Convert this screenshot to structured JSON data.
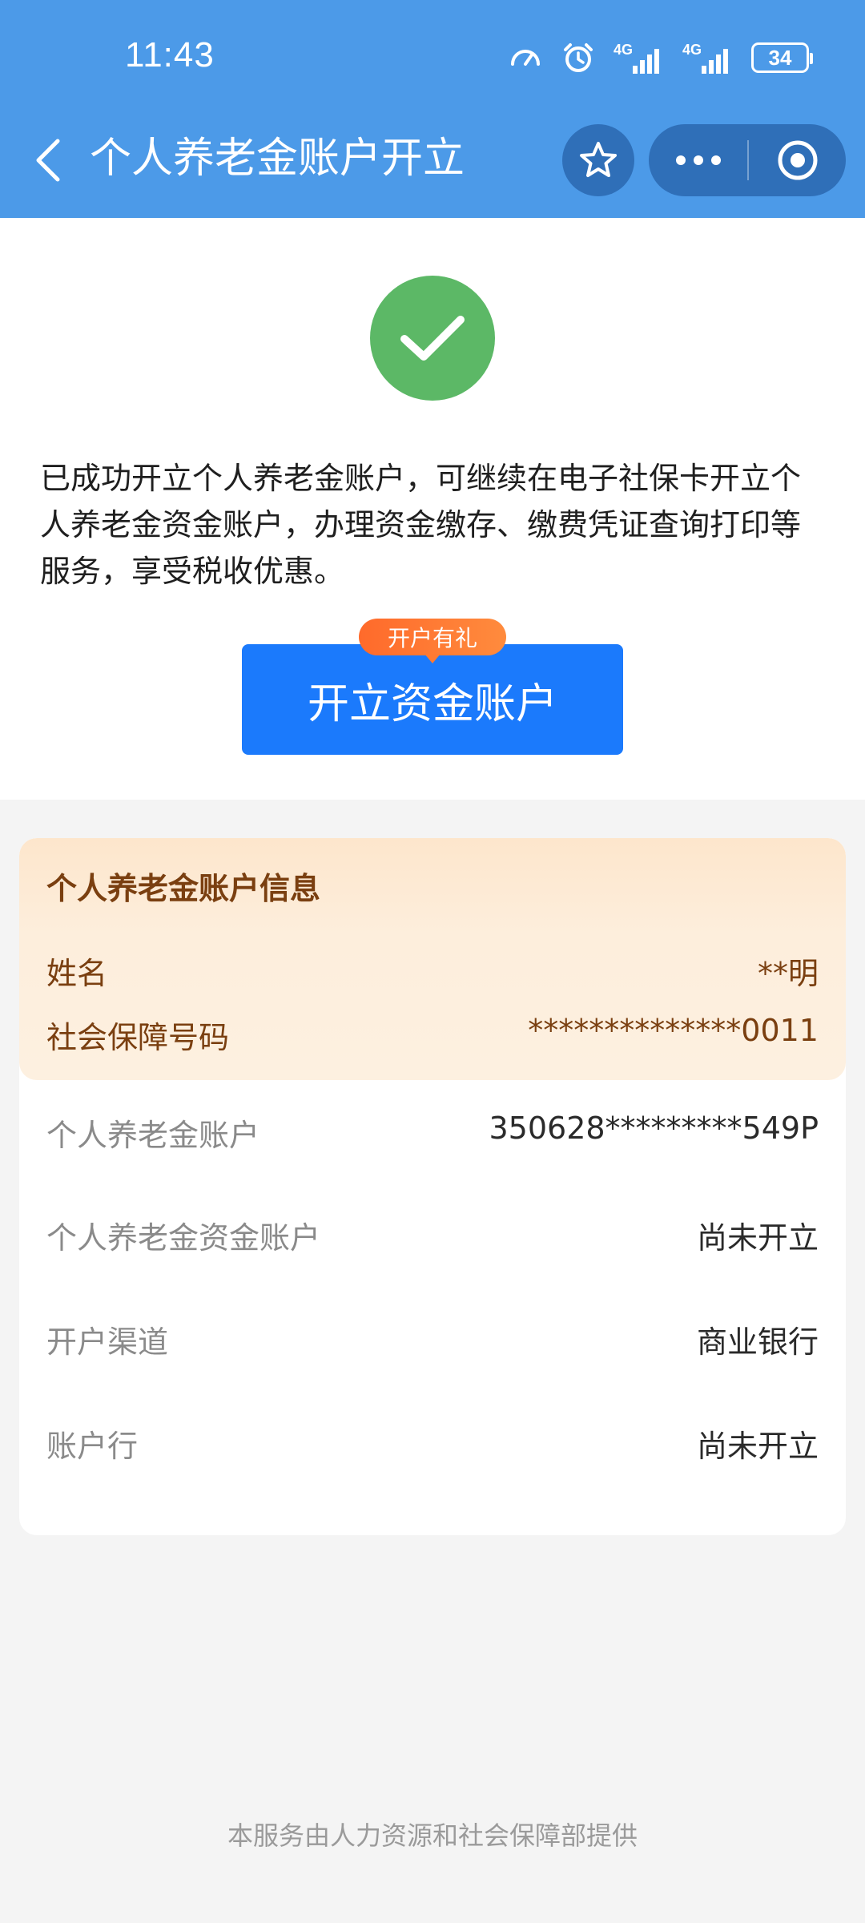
{
  "status_bar": {
    "time": "11:43",
    "network_1": "4G",
    "network_2": "4G",
    "battery": "34"
  },
  "nav": {
    "title": "个人养老金账户开立"
  },
  "success": {
    "message": "已成功开立个人养老金账户，可继续在电子社保卡开立个人养老金资金账户，办理资金缴存、缴费凭证查询打印等服务，享受税收优惠。",
    "button_label": "开立资金账户",
    "badge_label": "开户有礼"
  },
  "info": {
    "title": "个人养老金账户信息",
    "top_rows": [
      {
        "label": "姓名",
        "value": "**明"
      },
      {
        "label": "社会保障号码",
        "value": "**************0011"
      }
    ],
    "rows": [
      {
        "label": "个人养老金账户",
        "value": "350628*********549P"
      },
      {
        "label": "个人养老金资金账户",
        "value": "尚未开立"
      },
      {
        "label": "开户渠道",
        "value": "商业银行"
      },
      {
        "label": "账户行",
        "value": "尚未开立"
      }
    ]
  },
  "footer": {
    "text": "本服务由人力资源和社会保障部提供"
  },
  "colors": {
    "header": "#4c9ae8",
    "primary_button": "#1b7afc",
    "success_green": "#5cb866",
    "badge_orange": "#ff6a2b",
    "info_header_text": "#7a3f10"
  }
}
